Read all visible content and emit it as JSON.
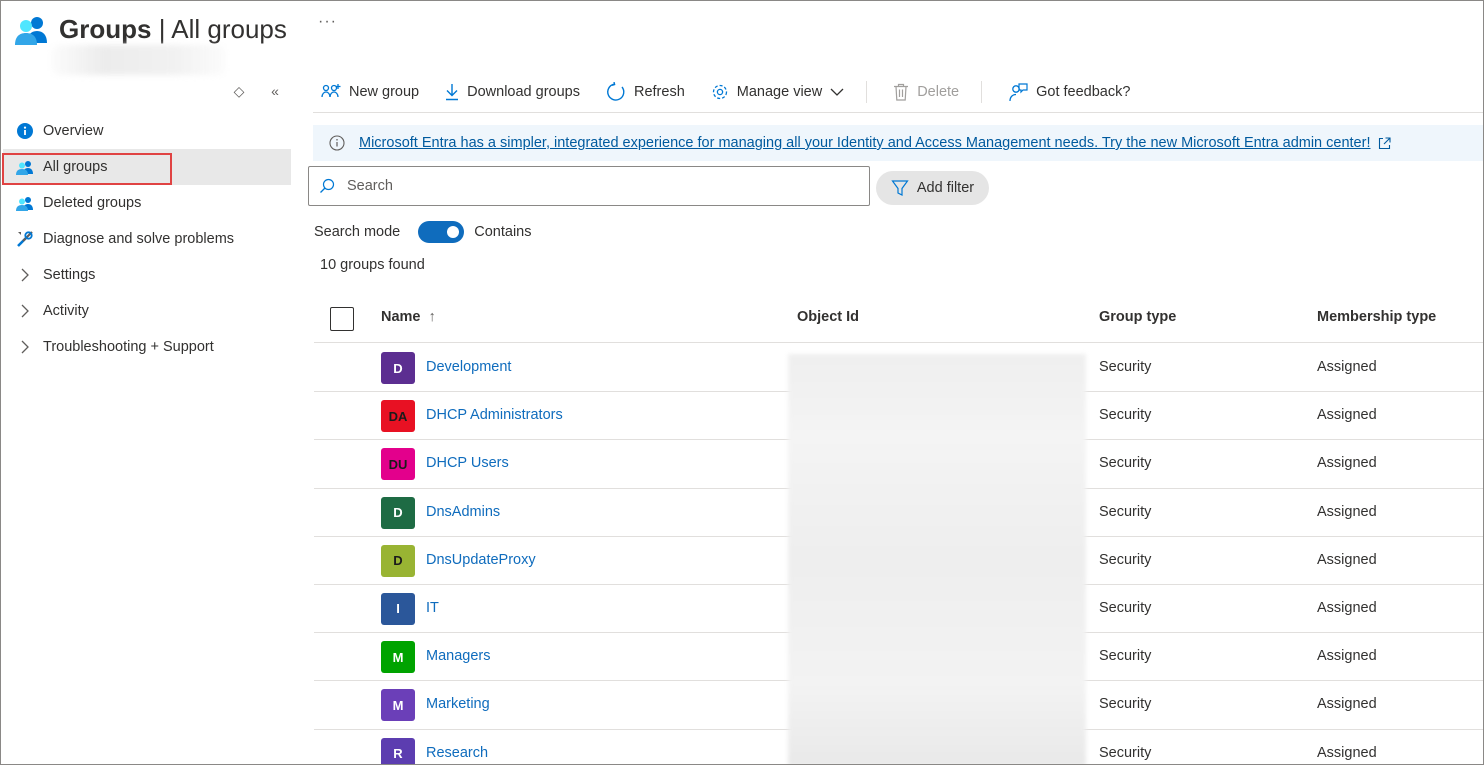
{
  "header": {
    "title_strong": "Groups",
    "title_sep": "|",
    "title_rest": "All groups",
    "more": "···"
  },
  "sidebar": {
    "tools": {
      "pin": "◇",
      "collapse": "«"
    },
    "items": [
      {
        "label": "Overview",
        "icon": "info-icon"
      },
      {
        "label": "All groups",
        "icon": "groups-icon"
      },
      {
        "label": "Deleted groups",
        "icon": "groups-icon"
      },
      {
        "label": "Diagnose and solve problems",
        "icon": "wrench-icon"
      },
      {
        "label": "Settings",
        "icon": "chevron-right-icon"
      },
      {
        "label": "Activity",
        "icon": "chevron-right-icon"
      },
      {
        "label": "Troubleshooting + Support",
        "icon": "chevron-right-icon"
      }
    ]
  },
  "toolbar": {
    "new_group": "New group",
    "download_groups": "Download groups",
    "refresh": "Refresh",
    "manage_view": "Manage view",
    "delete": "Delete",
    "feedback": "Got feedback?"
  },
  "banner": {
    "text": "Microsoft Entra has a simpler, integrated experience for managing all your Identity and Access Management needs. Try the new Microsoft Entra admin center!"
  },
  "search": {
    "placeholder": "Search",
    "add_filter": "Add filter",
    "mode_label": "Search mode",
    "mode_value": "Contains"
  },
  "results": {
    "count_text": "10 groups found"
  },
  "table": {
    "headers": {
      "name": "Name",
      "sort_indicator": "↑",
      "object_id": "Object Id",
      "group_type": "Group type",
      "membership_type": "Membership type"
    },
    "rows": [
      {
        "initials": "D",
        "name": "Development",
        "color": "#5c2e91",
        "type": "Security",
        "membership": "Assigned"
      },
      {
        "initials": "DA",
        "name": "DHCP Administrators",
        "color": "#e81123",
        "type": "Security",
        "membership": "Assigned"
      },
      {
        "initials": "DU",
        "name": "DHCP Users",
        "color": "#e3008c",
        "type": "Security",
        "membership": "Assigned"
      },
      {
        "initials": "D",
        "name": "DnsAdmins",
        "color": "#1e6b44",
        "type": "Security",
        "membership": "Assigned"
      },
      {
        "initials": "D",
        "name": "DnsUpdateProxy",
        "color": "#99b433",
        "type": "Security",
        "membership": "Assigned"
      },
      {
        "initials": "I",
        "name": "IT",
        "color": "#2b579a",
        "type": "Security",
        "membership": "Assigned"
      },
      {
        "initials": "M",
        "name": "Managers",
        "color": "#00a300",
        "type": "Security",
        "membership": "Assigned"
      },
      {
        "initials": "M",
        "name": "Marketing",
        "color": "#6b3fb8",
        "type": "Security",
        "membership": "Assigned"
      },
      {
        "initials": "R",
        "name": "Research",
        "color": "#5c3db0",
        "type": "Security",
        "membership": "Assigned"
      }
    ]
  },
  "colors": {
    "accent": "#0f6cbd",
    "highlight_box": "#e04343",
    "banner_bg": "#eff6fc"
  }
}
